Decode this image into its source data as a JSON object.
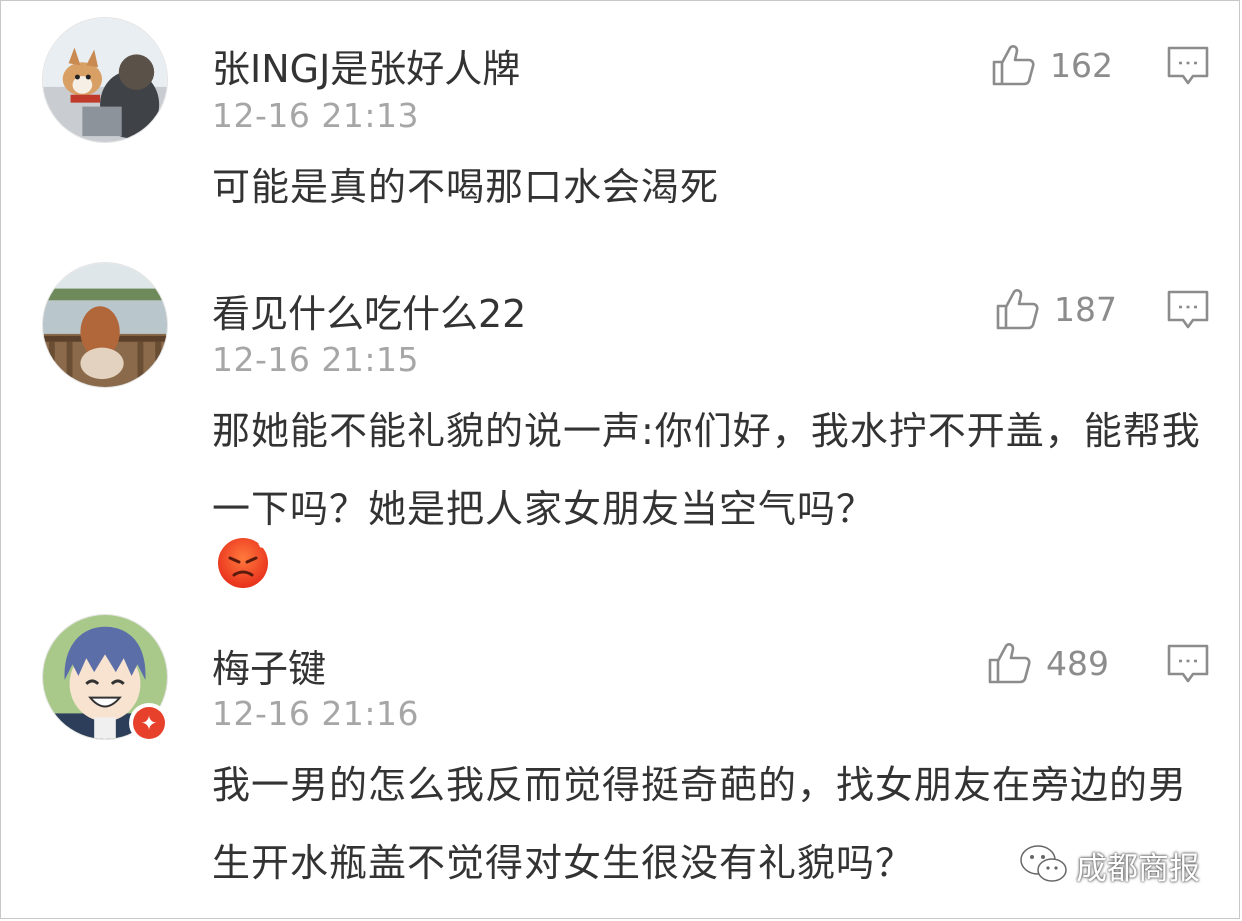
{
  "comments": [
    {
      "username": "张INGJ是张好人牌",
      "time": "12-16 21:13",
      "likes": "162",
      "text": "可能是真的不喝那口水会渴死",
      "avatar_icon": "dog-avatar"
    },
    {
      "username": "看见什么吃什么22",
      "time": "12-16 21:15",
      "likes": "187",
      "text": "那她能不能礼貌的说一声:你们好，我水拧不开盖，能帮我一下吗？她是把人家女朋友当空气吗？",
      "emoji": "angry-face-emoji",
      "avatar_icon": "lake-girl-avatar"
    },
    {
      "username": "梅子键",
      "time": "12-16 21:16",
      "likes": "489",
      "text": "我一男的怎么我反而觉得挺奇葩的，找女朋友在旁边的男生开水瓶盖不觉得对女生很没有礼貌吗？",
      "avatar_icon": "anime-boy-avatar",
      "badge_icon": "vip-star-badge"
    }
  ],
  "watermark": {
    "text": "成都商报",
    "icon": "wechat-icon"
  },
  "colors": {
    "username": "#333333",
    "time": "#a6a6a6",
    "like": "#8c8c8c",
    "badge": "#e8412b"
  }
}
